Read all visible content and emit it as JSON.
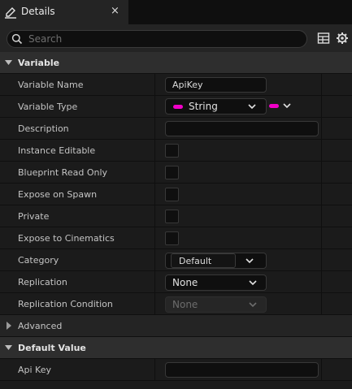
{
  "tab": {
    "title": "Details",
    "close": "×",
    "icon": "pencil-icon"
  },
  "search": {
    "placeholder": "Search",
    "value": ""
  },
  "sections": {
    "variable": "Variable",
    "advanced": "Advanced",
    "default_value": "Default Value"
  },
  "rows": {
    "variable_name": {
      "label": "Variable Name",
      "value": "ApiKey"
    },
    "variable_type": {
      "label": "Variable Type",
      "value": "String",
      "pin_color": "#f000c8"
    },
    "description": {
      "label": "Description",
      "value": ""
    },
    "instance_editable": {
      "label": "Instance Editable",
      "checked": false
    },
    "blueprint_read_only": {
      "label": "Blueprint Read Only",
      "checked": false
    },
    "expose_on_spawn": {
      "label": "Expose on Spawn",
      "checked": false
    },
    "private": {
      "label": "Private",
      "checked": false
    },
    "expose_to_cinematics": {
      "label": "Expose to Cinematics",
      "checked": false
    },
    "category": {
      "label": "Category",
      "value": "Default"
    },
    "replication": {
      "label": "Replication",
      "value": "None"
    },
    "replication_condition": {
      "label": "Replication Condition",
      "value": "None"
    },
    "api_key": {
      "label": "Api Key",
      "value": ""
    }
  },
  "colors": {
    "panel": "#1b1b1b",
    "section": "#2e2e2e",
    "input": "#0f0f0f",
    "accent_pin": "#f000c8"
  }
}
